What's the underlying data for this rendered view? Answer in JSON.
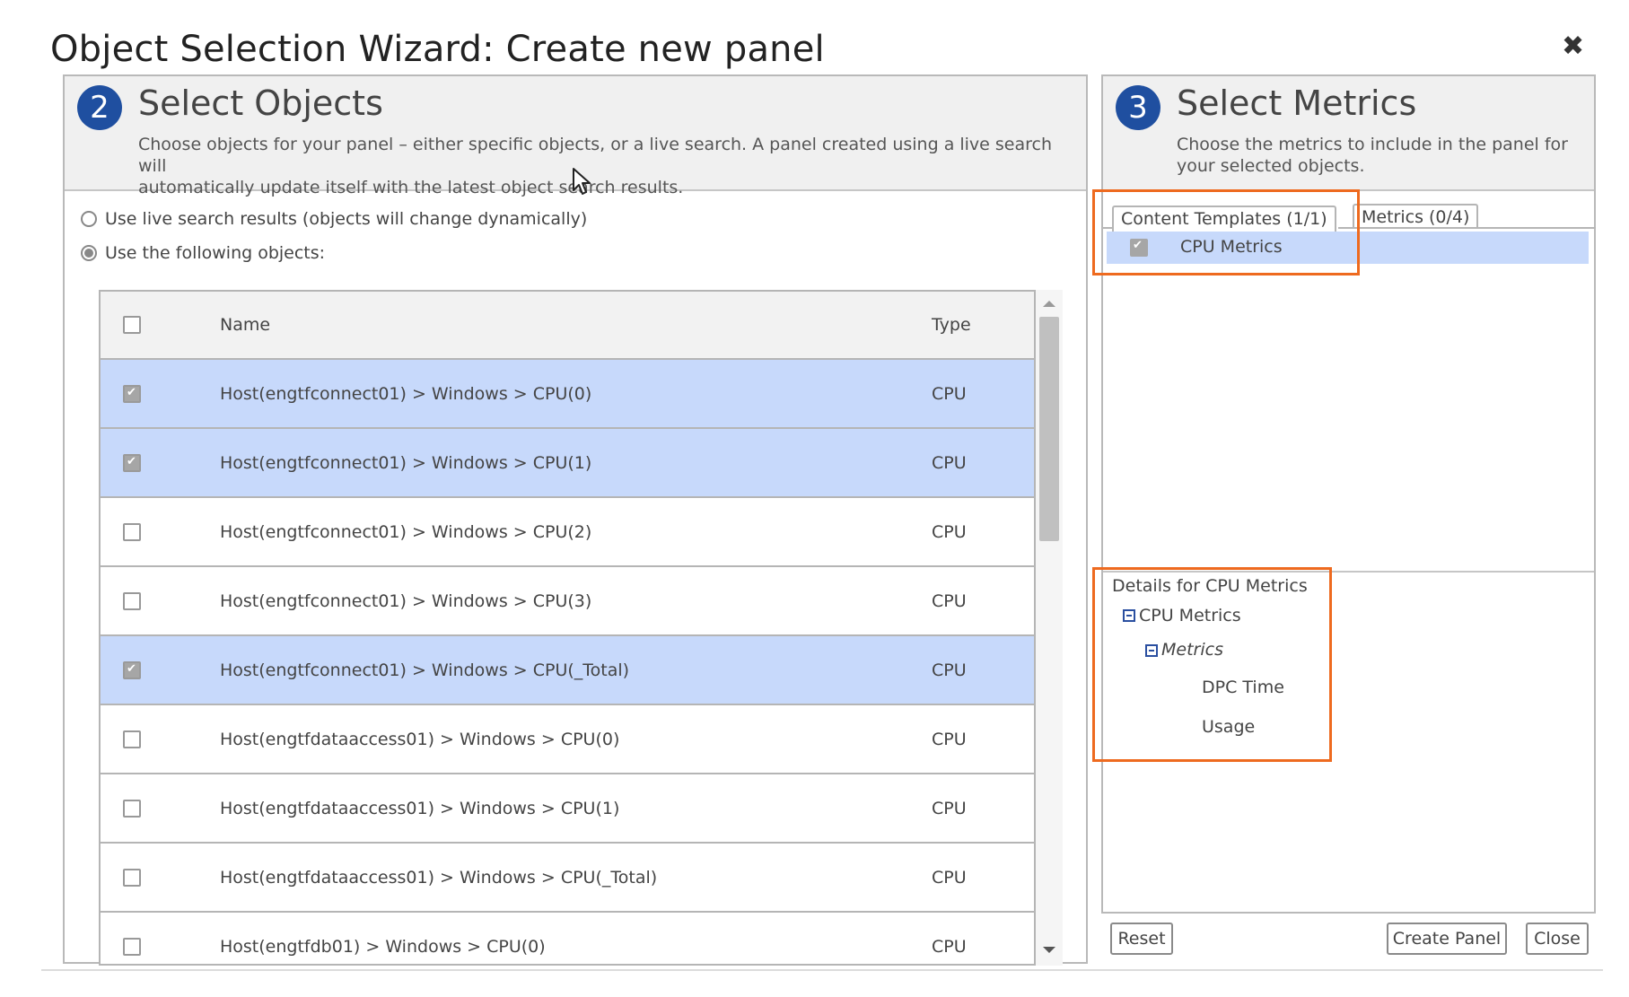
{
  "dialog": {
    "title": "Object Selection Wizard: Create new panel",
    "close_glyph": "✖"
  },
  "select_objects": {
    "step": "2",
    "title": "Select Objects",
    "description_line1": "Choose objects for your panel – either specific objects, or a live search. A panel created using a live search will",
    "description_line2": "automatically update itself with the latest object search results.",
    "radio_live": "Use live search results (objects will change dynamically)",
    "radio_following": "Use the following objects:",
    "selected_radio": "following",
    "columns": {
      "name": "Name",
      "type": "Type"
    },
    "rows": [
      {
        "name": "Host(engtfconnect01) > Windows > CPU(0)",
        "type": "CPU",
        "checked": true
      },
      {
        "name": "Host(engtfconnect01) > Windows > CPU(1)",
        "type": "CPU",
        "checked": true
      },
      {
        "name": "Host(engtfconnect01) > Windows > CPU(2)",
        "type": "CPU",
        "checked": false
      },
      {
        "name": "Host(engtfconnect01) > Windows > CPU(3)",
        "type": "CPU",
        "checked": false
      },
      {
        "name": "Host(engtfconnect01) > Windows > CPU(_Total)",
        "type": "CPU",
        "checked": true
      },
      {
        "name": "Host(engtfdataaccess01) > Windows > CPU(0)",
        "type": "CPU",
        "checked": false
      },
      {
        "name": "Host(engtfdataaccess01) > Windows > CPU(1)",
        "type": "CPU",
        "checked": false
      },
      {
        "name": "Host(engtfdataaccess01) > Windows > CPU(_Total)",
        "type": "CPU",
        "checked": false
      },
      {
        "name": "Host(engtfdb01) > Windows > CPU(0)",
        "type": "CPU",
        "checked": false
      }
    ]
  },
  "select_metrics": {
    "step": "3",
    "title": "Select Metrics",
    "description_line1": "Choose the metrics to include in the panel for",
    "description_line2": "your selected objects.",
    "tabs": {
      "content_templates": "Content Templates (1/1)",
      "metrics": "Metrics (0/4)"
    },
    "template_item": "CPU Metrics",
    "details": {
      "heading": "Details for CPU Metrics",
      "root": "CPU Metrics",
      "group": "Metrics",
      "items": [
        "DPC Time",
        "Usage"
      ]
    }
  },
  "buttons": {
    "reset": "Reset",
    "create_panel": "Create Panel",
    "close": "Close"
  },
  "colors": {
    "accent": "#1f4fa0",
    "selection": "#c7d9fb",
    "highlight": "#ee6a1f"
  }
}
